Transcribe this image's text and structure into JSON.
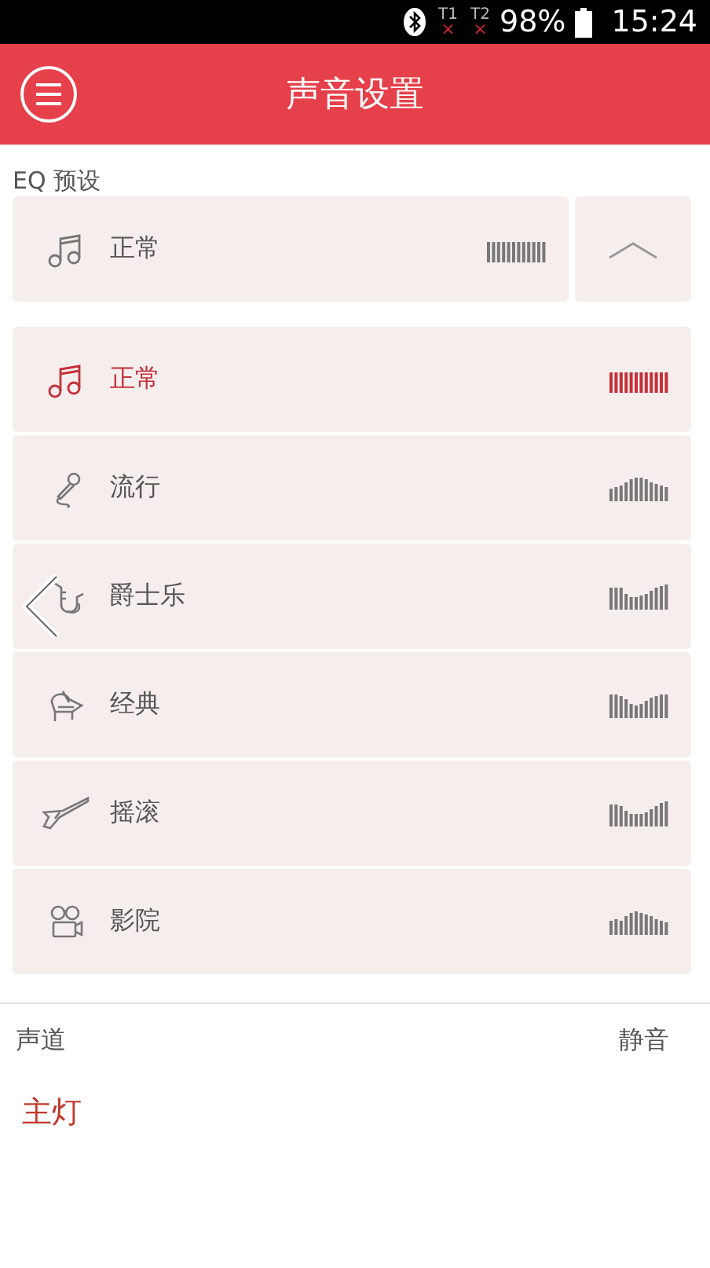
{
  "status_bar": {
    "sims": [
      {
        "label": "T1",
        "mark": "×"
      },
      {
        "label": "T2",
        "mark": "×"
      }
    ],
    "battery": "98%",
    "time": "15:24"
  },
  "header": {
    "title": "声音设置"
  },
  "eq": {
    "label": "EQ 预设",
    "current": {
      "kind": "note",
      "name": "正常"
    },
    "expanded": true,
    "presets": [
      {
        "kind": "note",
        "name": "正常",
        "selected": true
      },
      {
        "kind": "mic",
        "name": "流行",
        "selected": false
      },
      {
        "kind": "sax",
        "name": "爵士乐",
        "selected": false
      },
      {
        "kind": "piano",
        "name": "经典",
        "selected": false
      },
      {
        "kind": "guitar",
        "name": "摇滚",
        "selected": false
      },
      {
        "kind": "camera",
        "name": "影院",
        "selected": false
      }
    ]
  },
  "channel": {
    "label": "声道",
    "mute_label": "静音",
    "value": "主灯"
  }
}
